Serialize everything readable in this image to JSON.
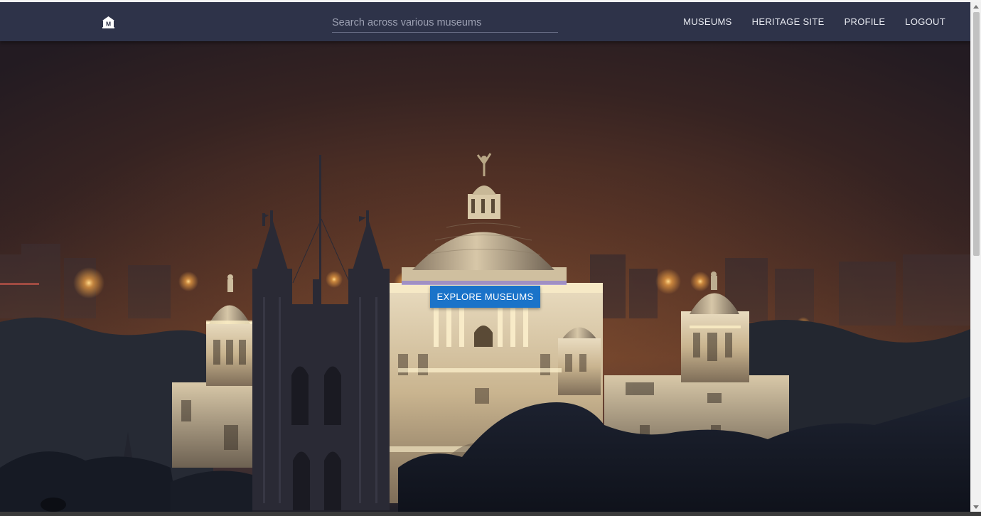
{
  "header": {
    "logo_icon": "museum-building-icon",
    "logo_letter": "M",
    "search": {
      "placeholder": "Search across various museums",
      "value": ""
    },
    "nav": [
      {
        "label": "MUSEUMS"
      },
      {
        "label": "HERITAGE SITE"
      },
      {
        "label": "PROFILE"
      },
      {
        "label": "LOGOUT"
      }
    ]
  },
  "hero": {
    "cta_label": "EXPLORE MUSEUMS",
    "image": "night-view-of-domed-marble-memorial-with-gothic-cathedral-spires"
  },
  "colors": {
    "header_bg": "#2e3349",
    "cta_bg": "#1a73c9",
    "nav_text": "#e6e8ef"
  }
}
